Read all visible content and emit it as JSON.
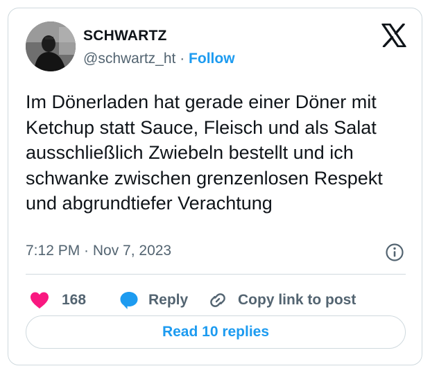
{
  "author": {
    "display_name": "SCHWARTZ",
    "handle": "@schwartz_ht",
    "separator": " · ",
    "follow_label": "Follow",
    "avatar_icon": "user-photo-avatar"
  },
  "brand": {
    "logo_icon": "x-logo-icon"
  },
  "tweet": {
    "text": "Im Dönerladen hat gerade einer Döner mit Ketchup statt Sauce, Fleisch und als Salat ausschließlich Zwiebeln bestellt und ich schwanke zwischen grenzenlosen Respekt und abgrundtiefer Verachtung",
    "timestamp": "7:12 PM · Nov 7, 2023"
  },
  "actions": {
    "like_count": "168",
    "reply_label": "Reply",
    "copy_label": "Copy link to post"
  },
  "replies": {
    "read_label": "Read 10 replies"
  },
  "colors": {
    "accent": "#1d9bf0",
    "like": "#f91880",
    "text": "#0f1419",
    "muted": "#536471",
    "border": "#cfd9de"
  }
}
